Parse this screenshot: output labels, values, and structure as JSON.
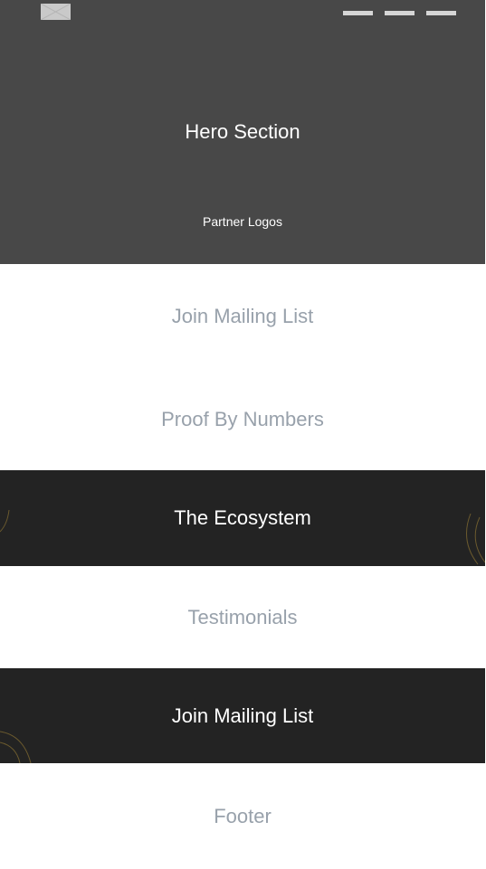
{
  "header": {
    "logo_icon": "image-placeholder-icon",
    "menu_icon": "menu-bars-icon"
  },
  "hero": {
    "title": "Hero Section",
    "partner_logos": "Partner Logos"
  },
  "sections": {
    "join_mailing_list_1": "Join Mailing List",
    "proof_by_numbers": "Proof By Numbers",
    "ecosystem": "The Ecosystem",
    "testimonials": "Testimonials",
    "join_mailing_list_2": "Join Mailing List",
    "footer": "Footer"
  },
  "colors": {
    "hero_bg": "#484848",
    "dark_bg": "#232323",
    "light_text": "#98a1ab",
    "accent_lines": "#6b5a2e"
  }
}
